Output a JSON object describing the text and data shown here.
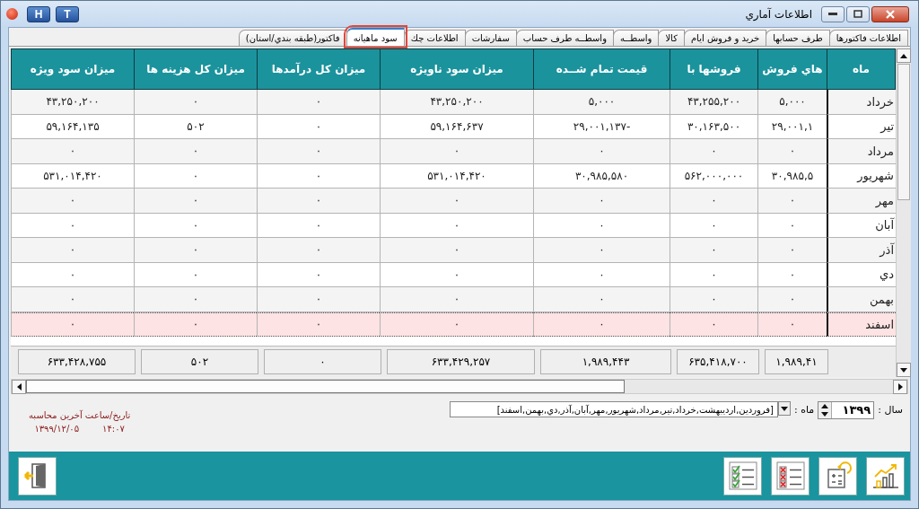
{
  "window": {
    "title": "اطلاعات آماري",
    "title_buttons": [
      "T",
      "H"
    ]
  },
  "tabs": [
    {
      "label": "اطلاعات فاكتورها",
      "selected": false
    },
    {
      "label": "طرف حسابها",
      "selected": false
    },
    {
      "label": "خريد و فروش ايام",
      "selected": false
    },
    {
      "label": "كالا",
      "selected": false
    },
    {
      "label": "واسطــه",
      "selected": false
    },
    {
      "label": "واسطــه طرف حساب",
      "selected": false
    },
    {
      "label": "سفارشات",
      "selected": false
    },
    {
      "label": "اطلاعات چك",
      "selected": false
    },
    {
      "label": "سود ماهيانه",
      "selected": true
    },
    {
      "label": "فاكتور(طبقه بندي/استان)",
      "selected": false
    }
  ],
  "table": {
    "columns": [
      "ماه",
      "هاي فروش",
      "فروشها با",
      "قيمت تمام شــده",
      "ميزان سود ناويژه",
      "ميزان كل درآمدها",
      "ميزان كل هزينه ها",
      "ميزان سود ويژه"
    ],
    "rows": [
      {
        "selected": false,
        "cells": [
          "خرداد",
          "۵,۰۰۰",
          "۴۳,۲۵۵,۲۰۰",
          "۵,۰۰۰",
          "۴۳,۲۵۰,۲۰۰",
          "۰",
          "۰",
          "۴۳,۲۵۰,۲۰۰"
        ]
      },
      {
        "selected": false,
        "cells": [
          "تير",
          "۲۹,۰۰۱,۱",
          "۳۰,۱۶۳,۵۰۰",
          "۲۹,۰۰۱,۱۳۷-",
          "۵۹,۱۶۴,۶۳۷",
          "۰",
          "۵۰۲",
          "۵۹,۱۶۴,۱۳۵"
        ]
      },
      {
        "selected": false,
        "cells": [
          "مرداد",
          "۰",
          "۰",
          "۰",
          "۰",
          "۰",
          "۰",
          "۰"
        ]
      },
      {
        "selected": false,
        "cells": [
          "شهريور",
          "۳۰,۹۸۵,۵",
          "۵۶۲,۰۰۰,۰۰۰",
          "۳۰,۹۸۵,۵۸۰",
          "۵۳۱,۰۱۴,۴۲۰",
          "۰",
          "۰",
          "۵۳۱,۰۱۴,۴۲۰"
        ]
      },
      {
        "selected": false,
        "cells": [
          "مهر",
          "۰",
          "۰",
          "۰",
          "۰",
          "۰",
          "۰",
          "۰"
        ]
      },
      {
        "selected": false,
        "cells": [
          "آبان",
          "۰",
          "۰",
          "۰",
          "۰",
          "۰",
          "۰",
          "۰"
        ]
      },
      {
        "selected": false,
        "cells": [
          "آذر",
          "۰",
          "۰",
          "۰",
          "۰",
          "۰",
          "۰",
          "۰"
        ]
      },
      {
        "selected": false,
        "cells": [
          "دي",
          "۰",
          "۰",
          "۰",
          "۰",
          "۰",
          "۰",
          "۰"
        ]
      },
      {
        "selected": false,
        "cells": [
          "بهمن",
          "۰",
          "۰",
          "۰",
          "۰",
          "۰",
          "۰",
          "۰"
        ]
      },
      {
        "selected": true,
        "cells": [
          "اسفند",
          "۰",
          "۰",
          "۰",
          "۰",
          "۰",
          "۰",
          "۰"
        ]
      }
    ]
  },
  "totals": [
    "۱,۹۸۹,۴۱",
    "۶۳۵,۴۱۸,۷۰۰",
    "۱,۹۸۹,۴۴۳",
    "۶۳۳,۴۲۹,۲۵۷",
    "۰",
    "۵۰۲",
    "۶۳۳,۴۲۸,۷۵۵"
  ],
  "filters": {
    "year_label": "سال :",
    "year": "۱۳۹۹",
    "month_label": "ماه :",
    "months": "[فروردين,ارديبهشت,خرداد,تير,مرداد,شهريور,مهر,آبان,آذر,دي,بهمن,اسفند]"
  },
  "last_calc": {
    "label": "تاريخ/ساعت آخرين محاسبه",
    "date": "۱۳۹۹/۱۲/۰۵",
    "time": "۱۴:۰۷"
  }
}
